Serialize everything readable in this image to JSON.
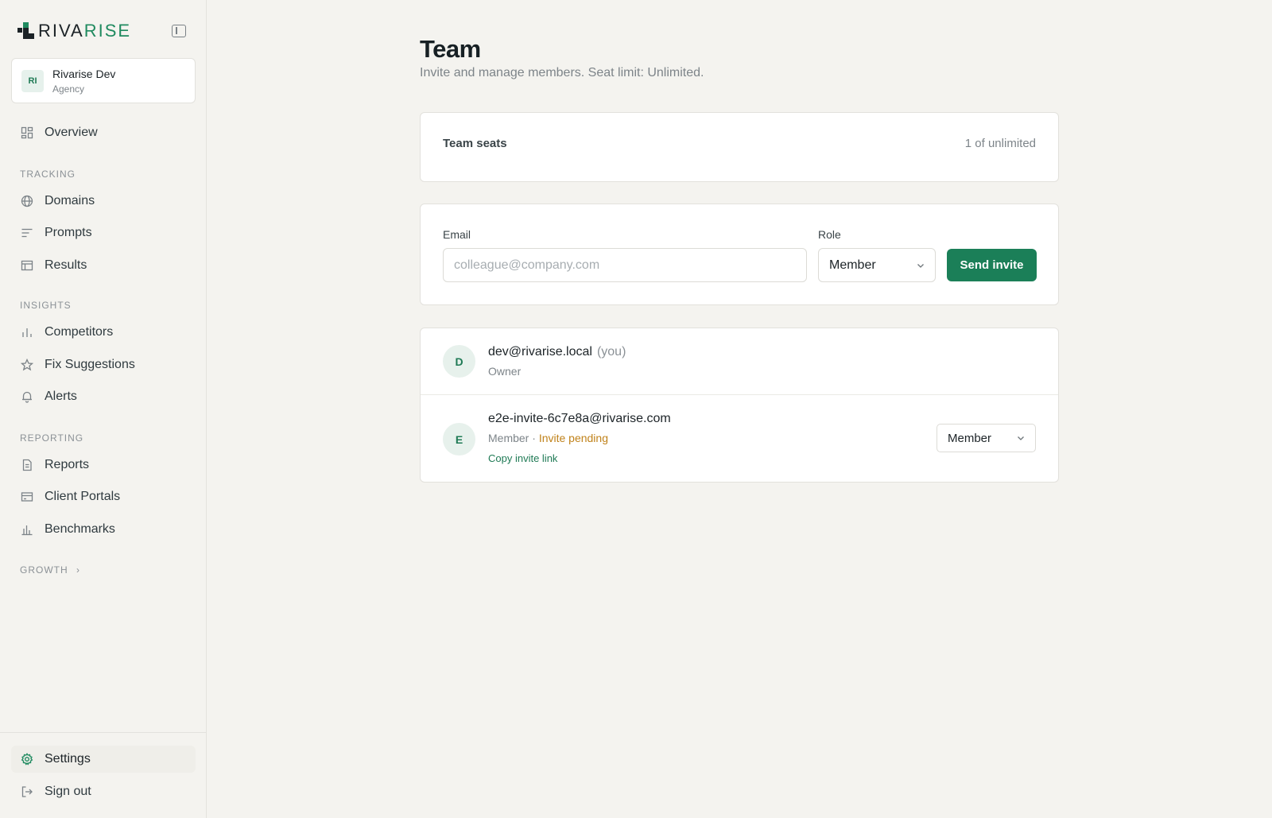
{
  "brand": {
    "name_part1": "RIVA",
    "name_part2": "RISE"
  },
  "org": {
    "initials": "RI",
    "name": "Rivarise Dev",
    "type": "Agency"
  },
  "nav": {
    "overview": "Overview",
    "sections": {
      "tracking": "TRACKING",
      "insights": "INSIGHTS",
      "reporting": "REPORTING",
      "growth": "GROWTH"
    },
    "tracking": [
      "Domains",
      "Prompts",
      "Results"
    ],
    "insights": [
      "Competitors",
      "Fix Suggestions",
      "Alerts"
    ],
    "reporting": [
      "Reports",
      "Client Portals",
      "Benchmarks"
    ],
    "settings": "Settings",
    "sign_out": "Sign out"
  },
  "page": {
    "title": "Team",
    "subtitle": "Invite and manage members. Seat limit: Unlimited."
  },
  "seats": {
    "label": "Team seats",
    "value": "1 of unlimited"
  },
  "invite": {
    "email_label": "Email",
    "email_placeholder": "colleague@company.com",
    "email_value": "",
    "role_label": "Role",
    "role_value": "Member",
    "send_label": "Send invite"
  },
  "members": [
    {
      "initial": "D",
      "email": "dev@rivarise.local",
      "you_tag": "(you)",
      "role": "Owner"
    },
    {
      "initial": "E",
      "email": "e2e-invite-6c7e8a@rivarise.com",
      "role": "Member",
      "separator": " · ",
      "status": "Invite pending",
      "copy_link": "Copy invite link",
      "role_select": "Member"
    }
  ],
  "colors": {
    "accent": "#1b7f58",
    "pending": "#c0821a",
    "background": "#f4f3ef"
  }
}
